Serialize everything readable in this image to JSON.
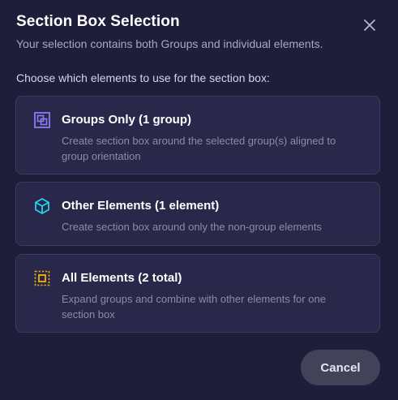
{
  "dialog": {
    "title": "Section Box Selection",
    "subtitle": "Your selection contains both Groups and individual elements.",
    "prompt": "Choose which elements to use for the section box:",
    "close_icon": "close-icon"
  },
  "options": [
    {
      "title": "Groups Only (1 group)",
      "description": "Create section box around the selected group(s) aligned to group orientation",
      "icon": "group-icon",
      "icon_color": "#8b7bf7"
    },
    {
      "title": "Other Elements (1 element)",
      "description": "Create section box around only the non-group elements",
      "icon": "cube-icon",
      "icon_color": "#22d3ee"
    },
    {
      "title": "All Elements (2 total)",
      "description": "Expand groups and combine with other elements for one section box",
      "icon": "select-all-icon",
      "icon_color": "#f5b400"
    }
  ],
  "footer": {
    "cancel_label": "Cancel"
  },
  "colors": {
    "background": "#1e1d3a",
    "card": "#29284a",
    "card_border": "#3b3a5f",
    "button": "#434258"
  }
}
